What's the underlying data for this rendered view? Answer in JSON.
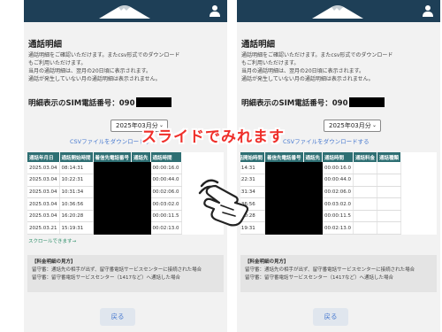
{
  "screen": {
    "title": "通話明細",
    "description": [
      "通話明細をご確認いただけます。またcsv形式でのダウンロード",
      "もご利用いただけます。",
      "当月の通話明細は、翌月の20日頃に表示されます。",
      "通話が発生していない月の通話明細は表示されません。"
    ],
    "sim_label": "明細表示のSIM電話番号：090",
    "month_select": "2025年03月分",
    "csv_link": "CSVファイルをダウンロードする",
    "table_headers": [
      "通話年月日",
      "通話開始時間",
      "着信先電話番号",
      "通話先",
      "通話時間",
      "通話料金",
      "通話種類"
    ],
    "rows": [
      {
        "date": "2025.03.04",
        "start": "08:14:31",
        "duration": "00:00:16.0"
      },
      {
        "date": "2025.03.04",
        "start": "10:22:31",
        "duration": "00:00:44.0"
      },
      {
        "date": "2025.03.04",
        "start": "10:31:34",
        "duration": "00:02:06.0"
      },
      {
        "date": "2025.03.04",
        "start": "10:36:56",
        "duration": "00:03:02.0"
      },
      {
        "date": "2025.03.04",
        "start": "16:20:28",
        "duration": "00:00:11.5"
      },
      {
        "date": "2025.03.21",
        "start": "15:19:31",
        "duration": "00:02:13.0"
      }
    ],
    "scroll_hint": "スクロールできます→",
    "fee_note": {
      "title": "【料金明細の見方】",
      "line1": "留守番：通話先の相手が出ず、留守番電話サービスセンターに接続された場合",
      "line2": "留守番：留守番電話サービスセンター（1417など）へ通話した場合"
    },
    "back_button": "戻る"
  },
  "overlay_text": "スライドでみれます",
  "icons": {
    "logo": "mountain-logo",
    "user": "user-icon",
    "hand": "swipe-hand-icon"
  },
  "colors": {
    "header": "#1e3f57",
    "table_header": "#2e6f73",
    "link": "#4a7bd0",
    "overlay": "#ef2f2a"
  }
}
